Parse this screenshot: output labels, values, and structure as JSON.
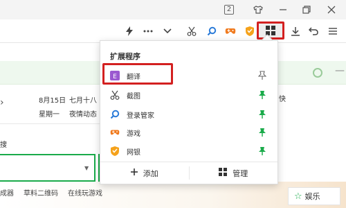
{
  "titlebar": {
    "badge_number": "2",
    "icons": [
      "tshirt-icon",
      "minimize-icon",
      "restore-icon",
      "close-icon"
    ]
  },
  "toolbar": {
    "icons": [
      "lightning-icon",
      "more-icon",
      "chevron-down-icon",
      "scissors-icon",
      "search-icon",
      "game-icon",
      "shield-icon",
      "extensions-grid-icon",
      "download-icon",
      "undo-icon",
      "menu-icon"
    ]
  },
  "page": {
    "date1": "8月15日",
    "weekday": "星期一",
    "lunar": "七月十八",
    "weather": "夜情动态",
    "side_text": "快",
    "label_cut": "搜",
    "bottom_links": [
      "成器",
      "草料二维码",
      "在线玩游戏"
    ],
    "entertainment": "娱乐"
  },
  "panel": {
    "title": "扩展程序",
    "items": [
      {
        "label": "翻译",
        "icon": "translate-icon",
        "color": "#9b59d0",
        "pinned": false
      },
      {
        "label": "截图",
        "icon": "scissors-icon",
        "color": "#555555",
        "pinned": true
      },
      {
        "label": "登录管家",
        "icon": "search-key-icon",
        "color": "#2b7bd8",
        "pinned": true
      },
      {
        "label": "游戏",
        "icon": "gamepad-icon",
        "color": "#f07a1e",
        "pinned": true
      },
      {
        "label": "网银",
        "icon": "shield-icon",
        "color": "#f5a21b",
        "pinned": true
      }
    ],
    "add_label": "添加",
    "manage_label": "管理"
  },
  "colors": {
    "accent_green": "#1aab4a",
    "highlight_red": "#d32020"
  }
}
